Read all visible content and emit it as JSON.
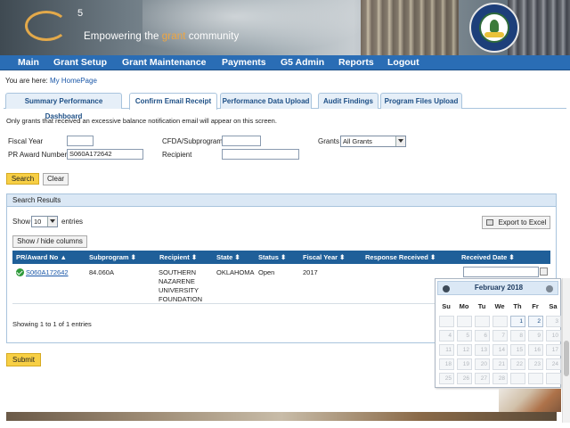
{
  "header": {
    "logo_superscript": "5",
    "tagline_before": "Empowering the ",
    "tagline_highlight": "grant",
    "tagline_after": " community"
  },
  "nav": [
    {
      "label": "Main"
    },
    {
      "label": "Grant Setup"
    },
    {
      "label": "Grant Maintenance"
    },
    {
      "label": "Payments"
    },
    {
      "label": "G5 Admin"
    },
    {
      "label": "Reports"
    },
    {
      "label": "Logout"
    }
  ],
  "breadcrumb": {
    "prefix": "You are here:",
    "link": "My HomePage"
  },
  "tabs": [
    {
      "label": "Summary Performance Dashboard"
    },
    {
      "label": "Confirm Email Receipt"
    },
    {
      "label": "Performance Data Upload"
    },
    {
      "label": "Audit Findings"
    },
    {
      "label": "Program Files Upload"
    }
  ],
  "note": "Only grants that received an excessive balance notification email will appear on this screen.",
  "filters": {
    "fiscal_year_label": "Fiscal Year",
    "fiscal_year_value": "",
    "pr_award_label": "PR Award Number",
    "pr_award_value": "S060A172642",
    "cfda_label": "CFDA/Subprogram",
    "cfda_value": "",
    "recipient_label": "Recipient",
    "recipient_value": "",
    "grants_label": "Grants",
    "grants_value": "All Grants"
  },
  "buttons": {
    "search": "Search",
    "clear": "Clear",
    "show_hide": "Show / hide columns",
    "export": "Export to Excel",
    "submit": "Submit"
  },
  "results": {
    "title": "Search Results",
    "show_label": "Show",
    "entries_value": "10",
    "entries_label": "entries",
    "columns": [
      "PR/Award No",
      "Subprogram",
      "Recipient",
      "State",
      "Status",
      "Fiscal Year",
      "Response Received",
      "Received Date"
    ],
    "rows": [
      {
        "award": "S060A172642",
        "subprogram": "84.060A",
        "recipient_lines": [
          "SOUTHERN",
          "NAZARENE",
          "UNIVERSITY",
          "FOUNDATION"
        ],
        "state": "OKLAHOMA",
        "status": "Open",
        "fiscal_year": "2017",
        "response": "",
        "received_date": ""
      }
    ],
    "info": "Showing 1 to 1 of 1 entries"
  },
  "datepicker": {
    "title": "February 2018",
    "weekdays": [
      "Su",
      "Mo",
      "Tu",
      "We",
      "Th",
      "Fr",
      "Sa"
    ],
    "weeks": [
      [
        "",
        "",
        "",
        "",
        "1",
        "2",
        "3"
      ],
      [
        "4",
        "5",
        "6",
        "7",
        "8",
        "9",
        "10"
      ],
      [
        "11",
        "12",
        "13",
        "14",
        "15",
        "16",
        "17"
      ],
      [
        "18",
        "19",
        "20",
        "21",
        "22",
        "23",
        "24"
      ],
      [
        "25",
        "26",
        "27",
        "28",
        "",
        "",
        ""
      ]
    ],
    "enabled_days": [
      "1",
      "2"
    ]
  }
}
